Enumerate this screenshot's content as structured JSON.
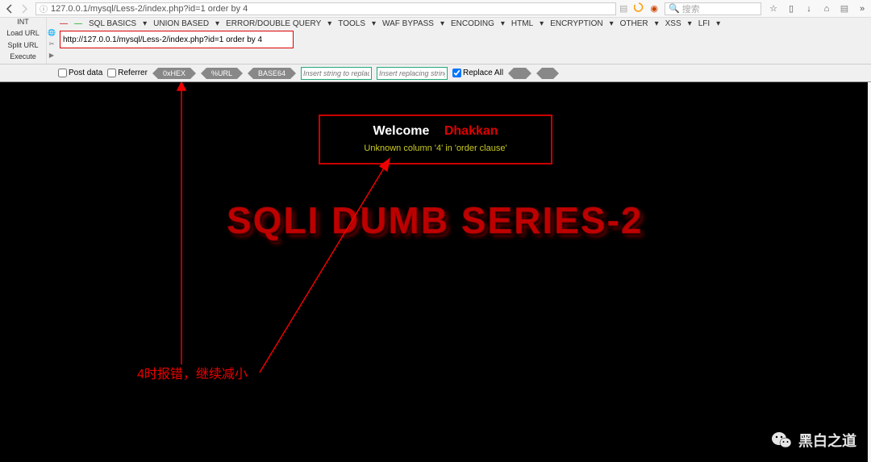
{
  "browser": {
    "url": "127.0.0.1/mysql/Less-2/index.php?id=1 order by 4",
    "search_placeholder": "搜索"
  },
  "hackbar": {
    "left": {
      "int": "INT",
      "load": "Load URL",
      "split": "Split URL",
      "exec": "Execute"
    },
    "menus": [
      "SQL BASICS",
      "UNION BASED",
      "ERROR/DOUBLE QUERY",
      "TOOLS",
      "WAF BYPASS",
      "ENCODING",
      "HTML",
      "ENCRYPTION",
      "OTHER",
      "XSS",
      "LFI"
    ],
    "input_value": "http://127.0.0.1/mysql/Less-2/index.php?id=1 order by 4"
  },
  "enc_row": {
    "post": "Post data",
    "ref": "Referrer",
    "hex": "0xHEX",
    "url": "%URL",
    "b64": "BASE64",
    "ins1": "Insert string to replace",
    "ins2": "Insert replacing string",
    "rep": "Replace All"
  },
  "page": {
    "welcome": "Welcome",
    "dhakkan": "Dhakkan",
    "error": "Unknown column '4' in 'order clause'",
    "title": "SQLI DUMB SERIES-2",
    "note": "4时报错，继续减小"
  },
  "watermark": "黑白之道"
}
